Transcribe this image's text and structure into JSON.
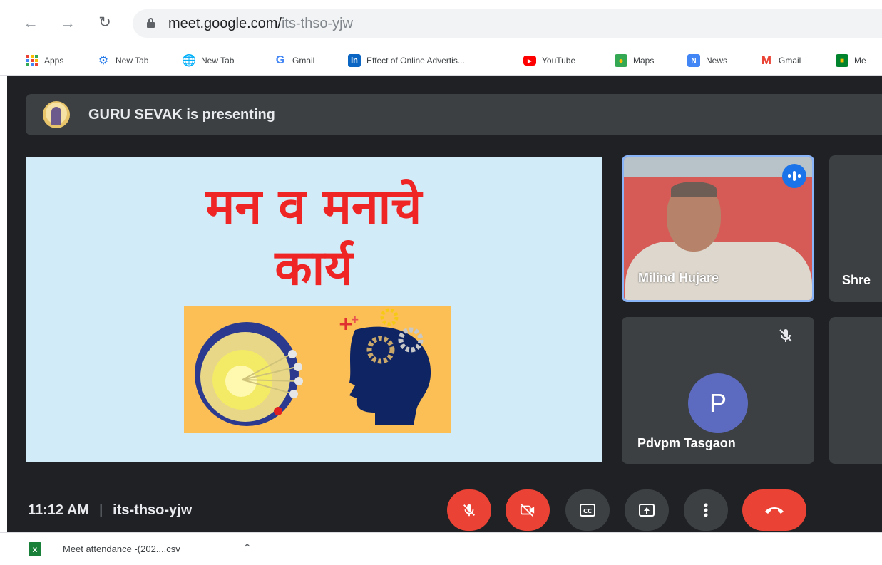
{
  "browser": {
    "url_host": "meet.google.com/",
    "url_path": "its-thso-yjw",
    "bookmarks": [
      {
        "label": "Apps",
        "icon": "apps-grid-icon"
      },
      {
        "label": "New Tab",
        "icon": "gear-icon"
      },
      {
        "label": "New Tab",
        "icon": "globe-icon"
      },
      {
        "label": "Gmail",
        "icon": "google-g-icon"
      },
      {
        "label": "Effect of Online Advertis...",
        "icon": "linkedin-icon"
      },
      {
        "label": "YouTube",
        "icon": "youtube-icon"
      },
      {
        "label": "Maps",
        "icon": "maps-icon"
      },
      {
        "label": "News",
        "icon": "news-icon"
      },
      {
        "label": "Gmail",
        "icon": "gmail-icon"
      },
      {
        "label": "Me",
        "icon": "meet-icon"
      }
    ]
  },
  "meet": {
    "presenting_text": "GURU SEVAK is presenting",
    "slide_title_line1": "मन व मनाचे",
    "slide_title_line2": "कार्य",
    "participants": [
      {
        "name": "Milind Hujare",
        "speaking": true
      },
      {
        "name": "Shre"
      },
      {
        "name": "Pdvpm Tasgaon",
        "initial": "P",
        "muted": true
      }
    ],
    "time": "11:12 AM",
    "separator": "|",
    "meeting_code": "its-thso-yjw"
  },
  "downloads": {
    "file_name": "Meet attendance -(202....csv"
  },
  "colors": {
    "meet_bg": "#202124",
    "tile_bg": "#3c4043",
    "slide_bg": "#d2ebf8",
    "slide_title": "#ef2424",
    "end_call_red": "#ea4335",
    "avatar_p": "#5c6bc0",
    "speaking_blue": "#1a73e8"
  }
}
